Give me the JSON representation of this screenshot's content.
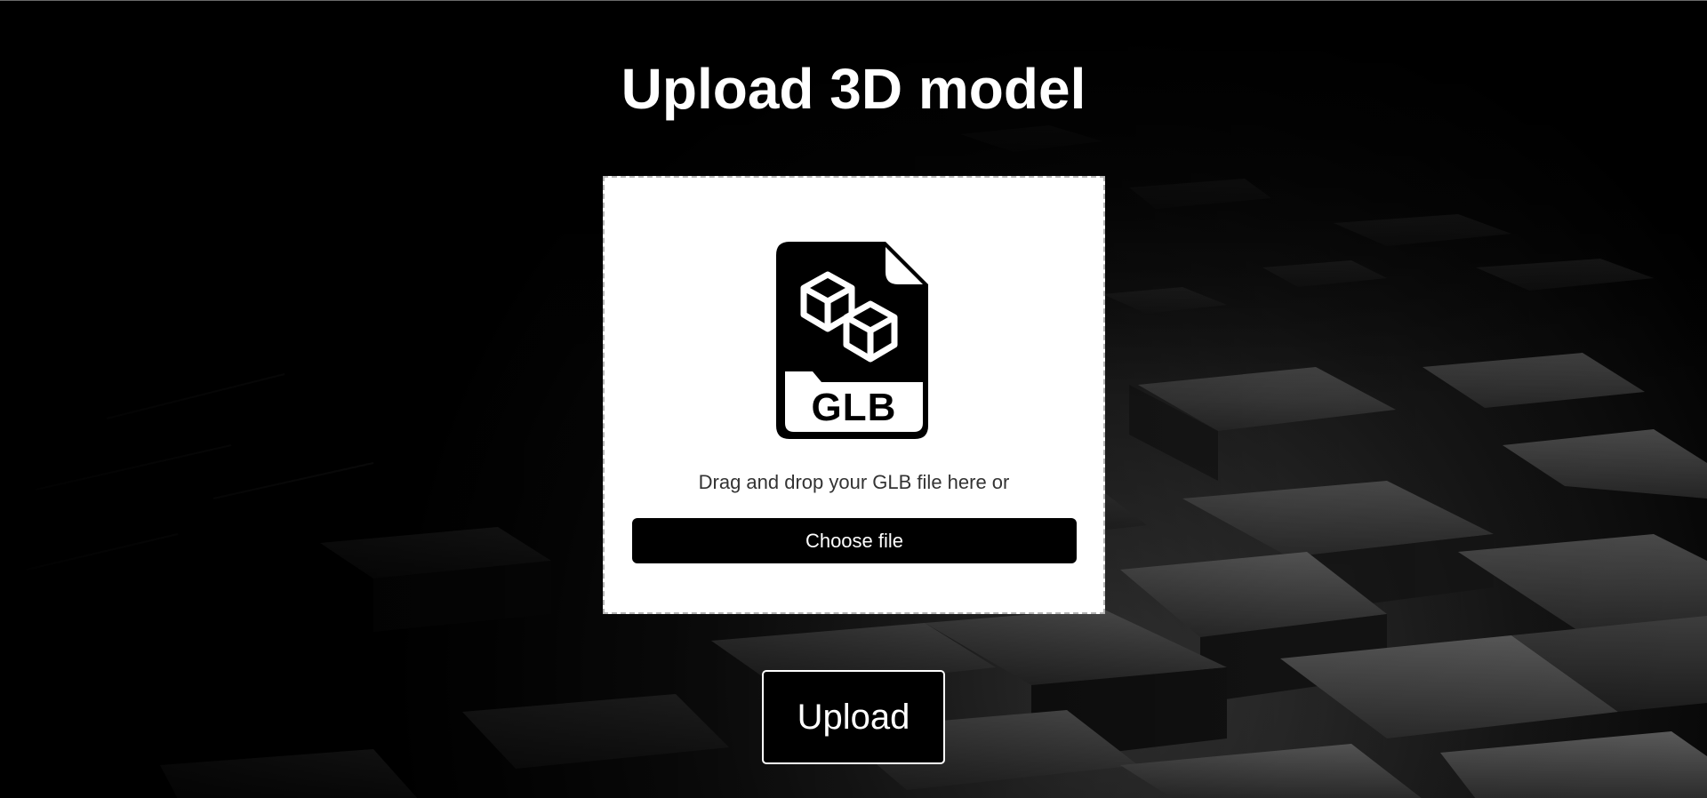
{
  "page": {
    "title": "Upload 3D model"
  },
  "dropzone": {
    "icon": "glb-file-icon",
    "icon_label": "GLB",
    "instruction": "Drag and drop your GLB file here or",
    "choose_label": "Choose file"
  },
  "actions": {
    "upload_label": "Upload"
  },
  "colors": {
    "background": "#000000",
    "card": "#ffffff",
    "button": "#000000",
    "text_light": "#ffffff",
    "text_dark": "#333333"
  }
}
